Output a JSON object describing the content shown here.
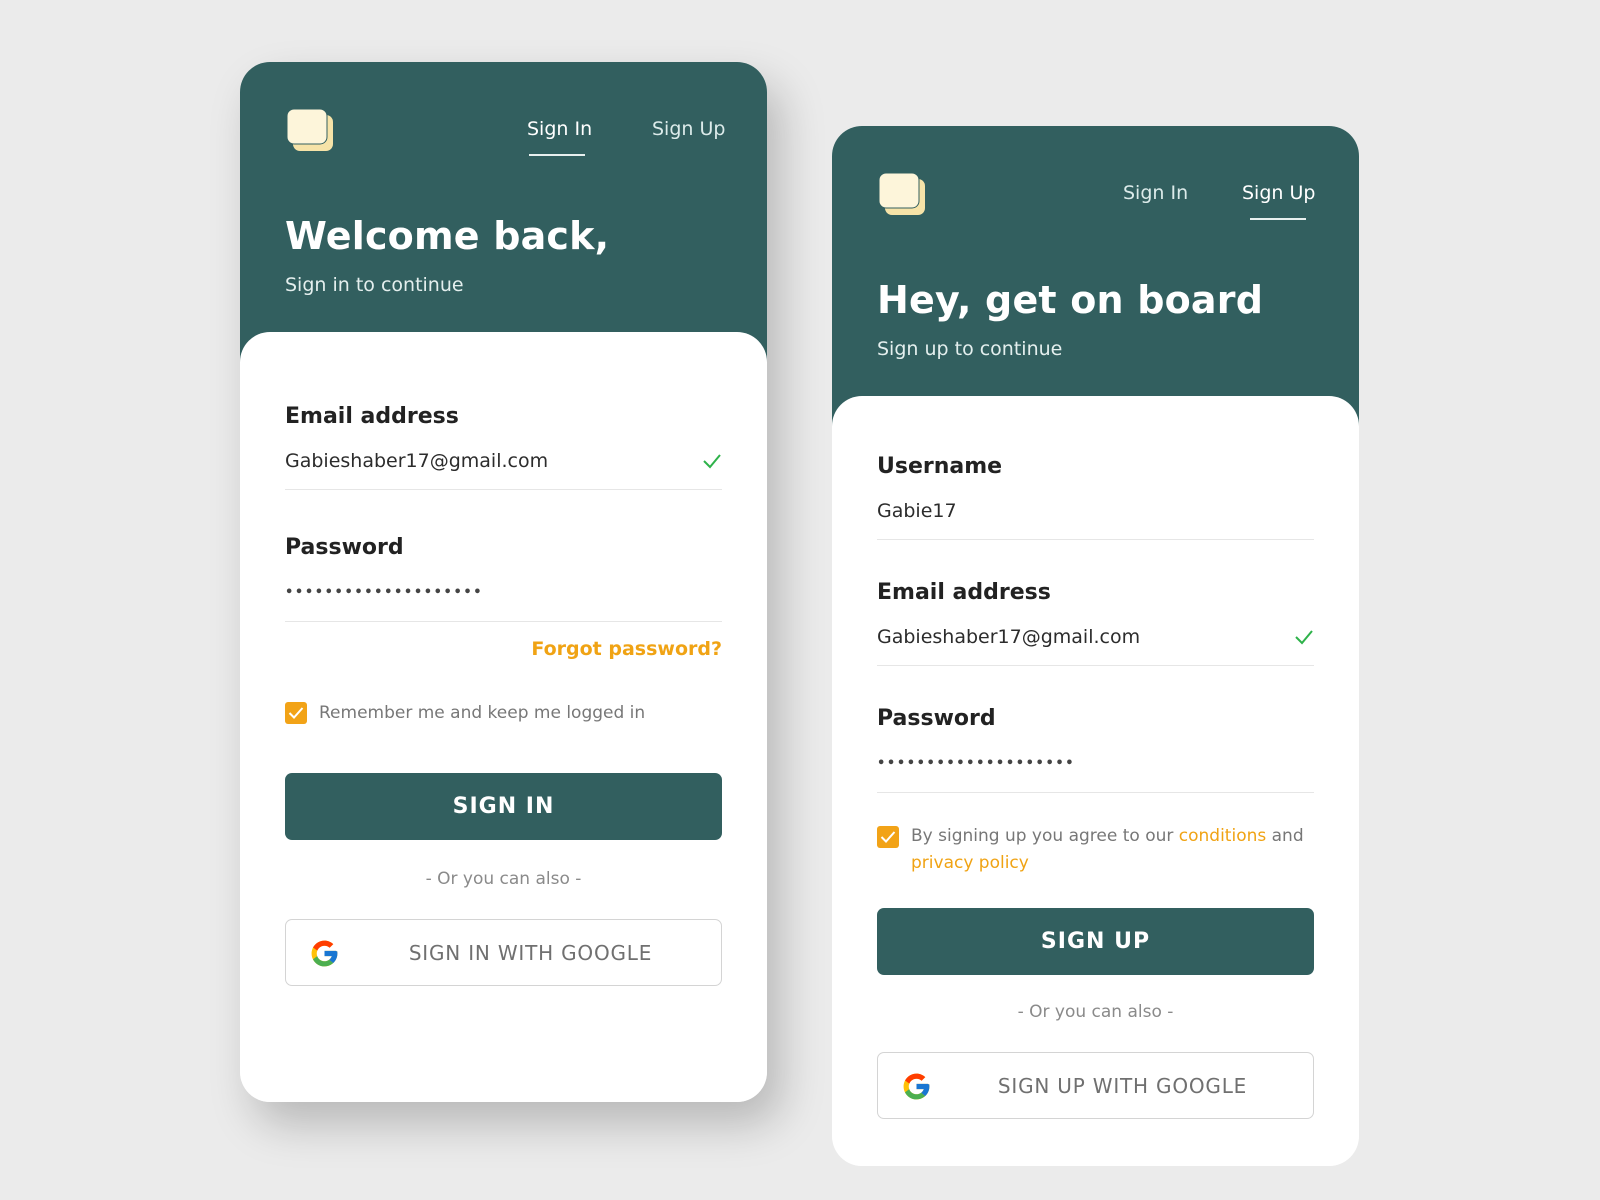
{
  "colors": {
    "brand_green": "#325f5f",
    "accent_orange": "#f2a317",
    "check_green": "#2eb24a",
    "background": "#ebebeb"
  },
  "signin_card": {
    "nav": {
      "sign_in": "Sign In",
      "sign_up": "Sign Up",
      "active": "sign_in"
    },
    "title": "Welcome back,",
    "subtitle": "Sign in to continue",
    "email": {
      "label": "Email address",
      "value": "Gabieshaber17@gmail.com",
      "valid_icon": "check-icon"
    },
    "password": {
      "label": "Password",
      "value": "••••••••••••••••••••"
    },
    "forgot_password": "Forgot password?",
    "remember": {
      "checked": true,
      "label": "Remember me and keep me logged in"
    },
    "primary_button": "SIGN IN",
    "divider_text": "- Or you can also -",
    "google_button": {
      "icon": "google-icon",
      "label": "SIGN IN WITH GOOGLE"
    }
  },
  "signup_card": {
    "nav": {
      "sign_in": "Sign In",
      "sign_up": "Sign Up",
      "active": "sign_up"
    },
    "title": "Hey, get on board",
    "subtitle": "Sign up to continue",
    "username": {
      "label": "Username",
      "value": "Gabie17"
    },
    "email": {
      "label": "Email address",
      "value": "Gabieshaber17@gmail.com",
      "valid_icon": "check-icon"
    },
    "password": {
      "label": "Password",
      "value": "••••••••••••••••••••"
    },
    "agree": {
      "checked": true,
      "text_before": "By signing up you agree to our ",
      "conditions_link": "conditions",
      "text_middle": " and",
      "privacy_link": "privacy policy"
    },
    "primary_button": "SIGN UP",
    "divider_text": "- Or you can also -",
    "google_button": {
      "icon": "google-icon",
      "label": "SIGN UP WITH GOOGLE"
    }
  }
}
